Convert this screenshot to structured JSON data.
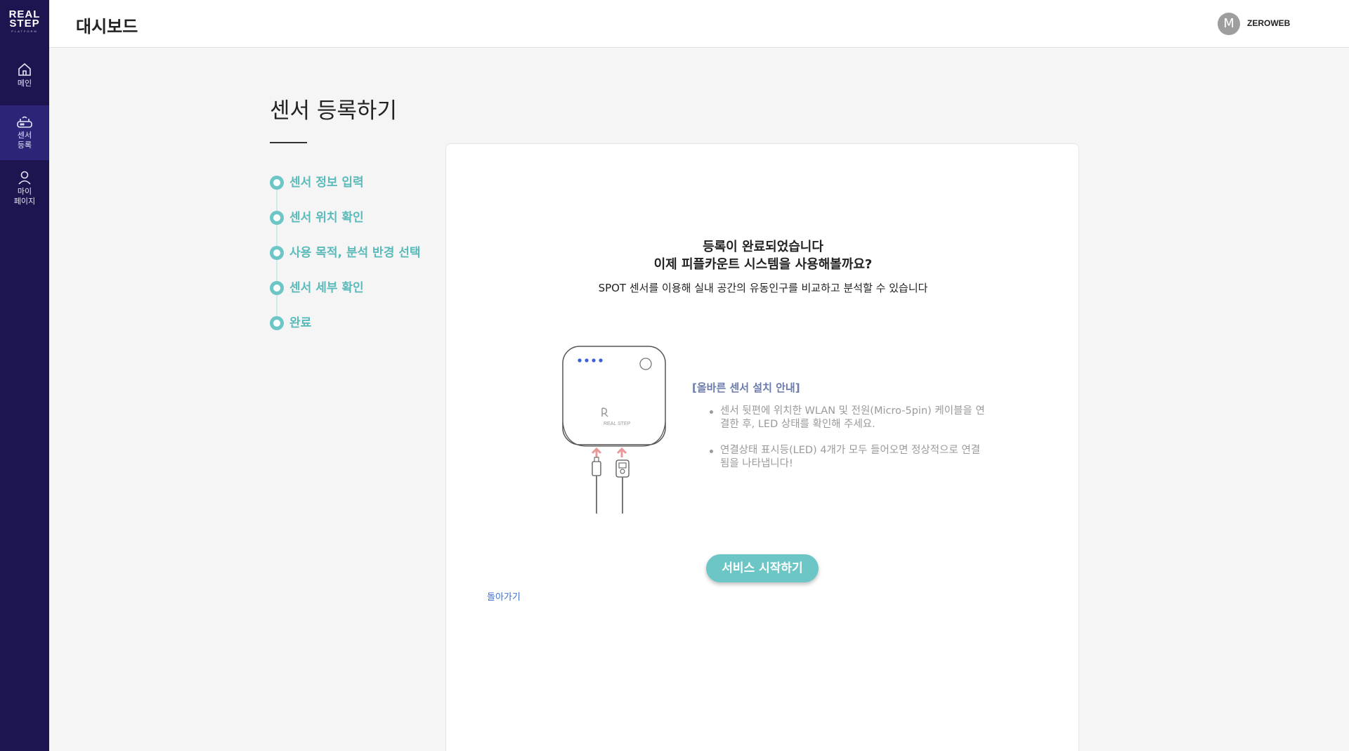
{
  "brand": {
    "line1": "REAL",
    "line2": "STEP",
    "sub": "PLATFORM"
  },
  "sidebar": {
    "items": [
      {
        "label": "메인",
        "icon": "home-icon"
      },
      {
        "label_line1": "센서",
        "label_line2": "등록",
        "icon": "router-icon",
        "active": true
      },
      {
        "label_line1": "마이",
        "label_line2": "페이지",
        "icon": "user-icon"
      }
    ]
  },
  "header": {
    "title": "대시보드",
    "avatar_initial": "M",
    "username": "ZEROWEB"
  },
  "page": {
    "title": "센서 등록하기"
  },
  "steps": [
    {
      "label": "센서 정보 입력"
    },
    {
      "label": "센서 위치 확인"
    },
    {
      "label": "사용 목적, 분석 반경 선택"
    },
    {
      "label": "센서 세부 확인"
    },
    {
      "label": "완료"
    }
  ],
  "card": {
    "title_line1": "등록이 완료되었습니다",
    "title_line2": "이제 피플카운트 시스템을 사용해볼까요?",
    "description": "SPOT 센서를 이용해 실내 공간의 유동인구를 비교하고 분석할 수 있습니다",
    "device_brand": "REAL STEP",
    "guide_title": "[올바른 센서 설치 안내]",
    "guide_items": [
      "센서 뒷편에 위치한 WLAN 및 전원(Micro-5pin) 케이블을 연결한 후, LED 상태를 확인해 주세요.",
      "연결상태 표시등(LED) 4개가 모두 들어오면 정상적으로 연결됨을 나타냅니다!"
    ],
    "start_button": "서비스 시작하기",
    "back_link": "돌아가기"
  },
  "colors": {
    "sidebar": "#1c1550",
    "sidebar_active": "#2c2577",
    "accent": "#6cc6c6",
    "link": "#3f6fc7",
    "led": "#3a5fd8"
  }
}
